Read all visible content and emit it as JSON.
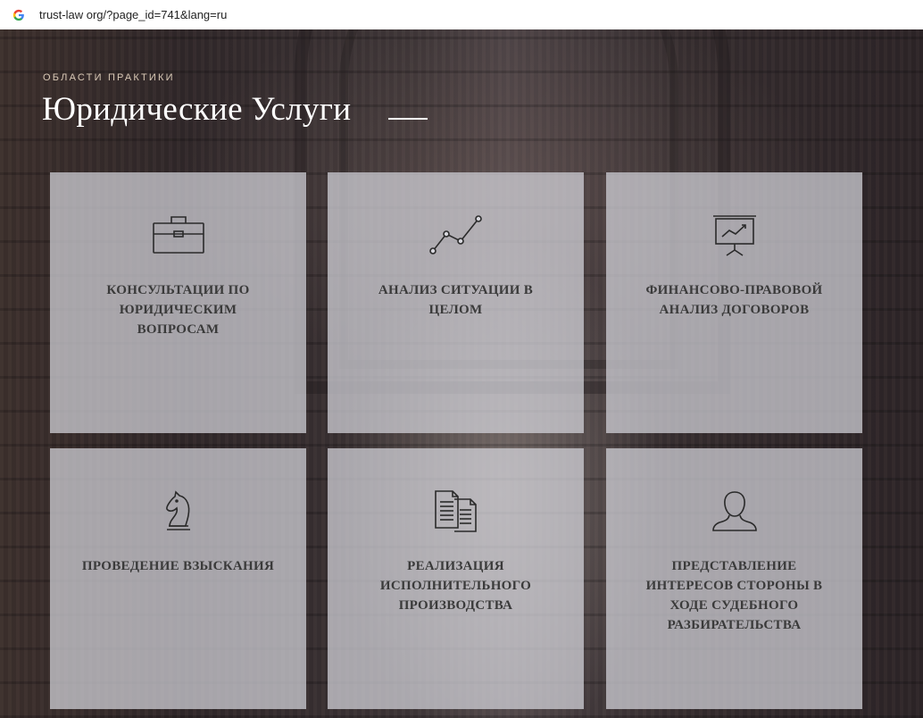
{
  "browser": {
    "url": "trust-law org/?page_id=741&lang=ru"
  },
  "hero": {
    "eyebrow": "ОБЛАСТИ ПРАКТИКИ",
    "title": "Юридические Услуги"
  },
  "cards": [
    {
      "label": "КОНСУЛЬТАЦИИ ПО ЮРИДИЧЕСКИМ ВОПРОСАМ",
      "icon": "briefcase-icon"
    },
    {
      "label": "АНАЛИЗ СИТУАЦИИ В ЦЕЛОМ",
      "icon": "line-chart-icon"
    },
    {
      "label": "ФИНАНСОВО-ПРАВОВОЙ АНАЛИЗ ДОГОВОРОВ",
      "icon": "presentation-board-icon"
    },
    {
      "label": "ПРОВЕДЕНИЕ ВЗЫСКАНИЯ",
      "icon": "chess-knight-icon"
    },
    {
      "label": "РЕАЛИЗАЦИЯ ИСПОЛНИТЕЛЬНОГО ПРОИЗВОДСТВА",
      "icon": "documents-icon"
    },
    {
      "label": "ПРЕДСТАВЛЕНИЕ ИНТЕРЕСОВ СТОРОНЫ В ХОДЕ СУДЕБНОГО РАЗБИРАТЕЛЬСТВА",
      "icon": "person-icon"
    }
  ],
  "colors": {
    "card_bg": "#d6d6dc",
    "card_text": "#3a3a3a",
    "eyebrow": "#d9c9b6",
    "icon_stroke": "#2a2a2a"
  }
}
